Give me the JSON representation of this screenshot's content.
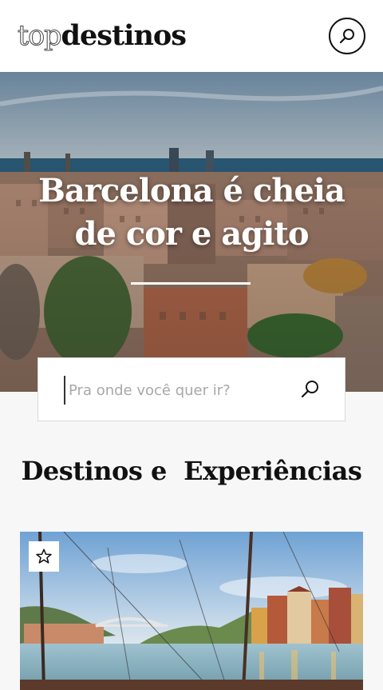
{
  "header": {
    "logo_light": "top",
    "logo_bold": "destinos",
    "search_icon": "search-icon"
  },
  "hero": {
    "title_line1": "Barcelona é cheia",
    "title_line2": "de cor e agito"
  },
  "search": {
    "placeholder": "Pra onde você quer ir?",
    "value": "",
    "icon": "search-icon"
  },
  "section": {
    "title": "Destinos e  Experiências"
  },
  "card": {
    "favorite_icon": "star-outline-icon"
  },
  "colors": {
    "text": "#111111",
    "accent_white": "#ffffff",
    "page_bg": "#f7f7f7"
  }
}
